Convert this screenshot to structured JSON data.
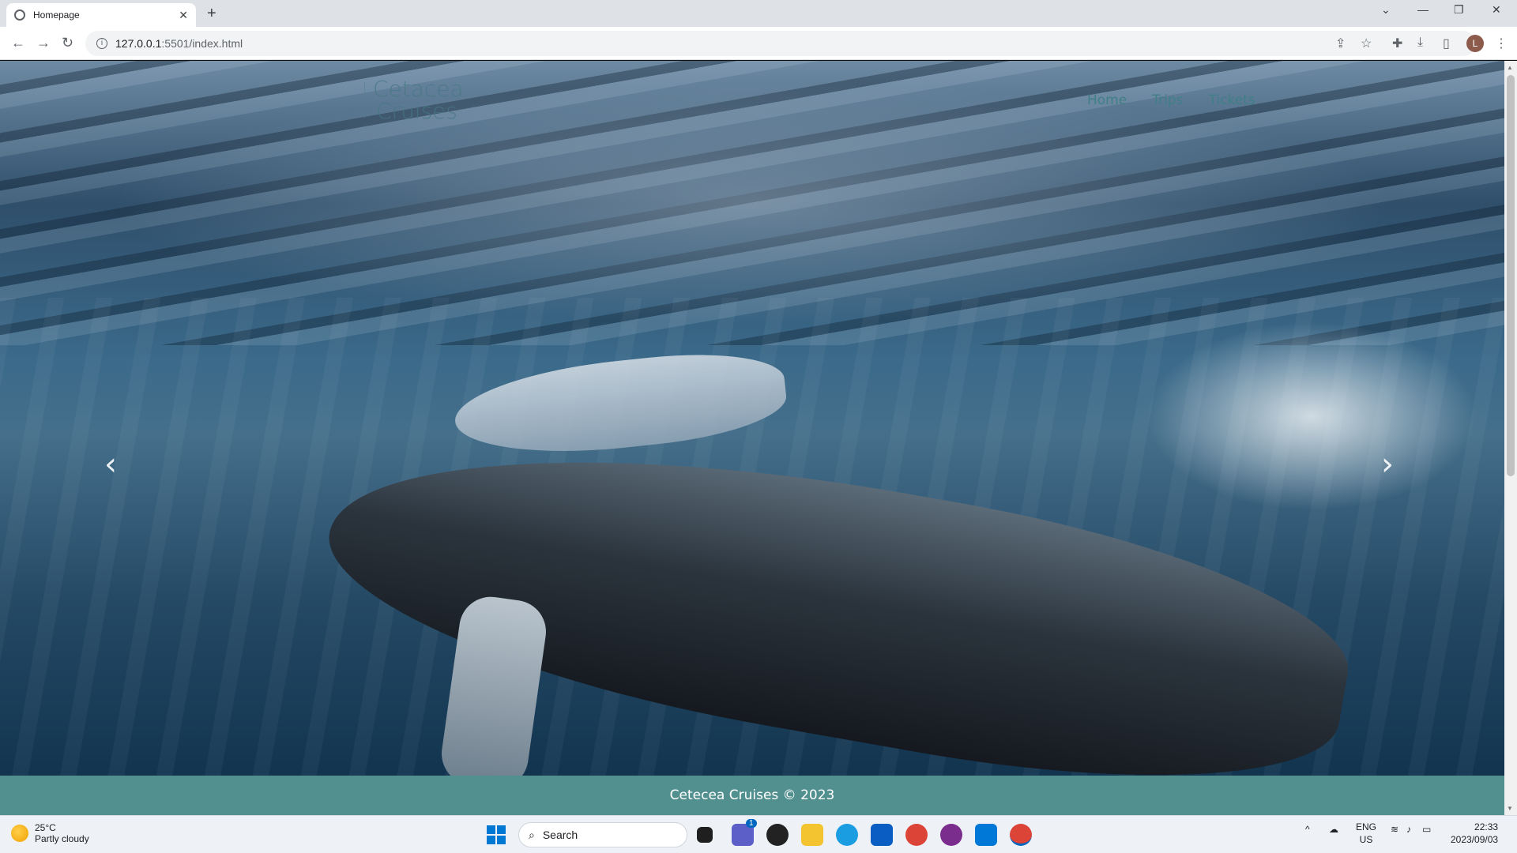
{
  "browser": {
    "tab_title": "Homepage",
    "new_tab": "+",
    "tab_close": "✕",
    "url_host": "127.0.0.1",
    "url_path": ":5501/index.html",
    "profile_initial": "L"
  },
  "site": {
    "brand_name_line1": "Cetacea",
    "brand_name_line2": "Cruises",
    "nav": [
      "Home",
      "Trips",
      "Tickets"
    ],
    "footer_text": "Cetecea Cruises © 2023"
  },
  "taskbar": {
    "temperature": "25°C",
    "weather": "Partly cloudy",
    "search_placeholder": "Search",
    "lang_line1": "ENG",
    "lang_line2": "US",
    "time": "22:33",
    "date": "2023/09/03",
    "badge_count": "1"
  },
  "colors": {
    "footer": "#52908f",
    "nav_link": "#3f7f86"
  },
  "icons": [
    "back-icon",
    "forward-icon",
    "reload-icon",
    "share-icon",
    "star-icon",
    "extensions-icon",
    "download-icon",
    "sidebar-icon",
    "menu-icon",
    "prev-arrow-icon",
    "next-arrow-icon"
  ]
}
